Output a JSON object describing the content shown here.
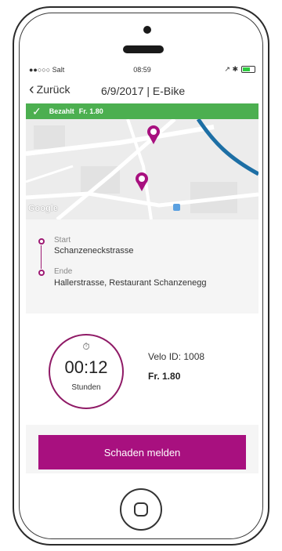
{
  "status_bar": {
    "carrier": "●●○○○ Salt",
    "time": "08:59",
    "right": "↗ ✱"
  },
  "nav": {
    "back_label": "Zurück",
    "title": "6/9/2017 | E-Bike"
  },
  "payment": {
    "status_label": "Bezahlt",
    "amount": "Fr. 1.80",
    "color": "#4caf50"
  },
  "map": {
    "attribution": "Google"
  },
  "route": {
    "start_label": "Start",
    "start_value": "Schanzeneckstrasse",
    "end_label": "Ende",
    "end_value": "Hallerstrasse, Restaurant Schanzenegg"
  },
  "ride": {
    "duration": "00:12",
    "duration_unit": "Stunden",
    "velo_id": "Velo ID: 1008",
    "price": "Fr. 1.80",
    "accent": "#a8107f"
  },
  "actions": {
    "report_damage": "Schaden melden"
  }
}
